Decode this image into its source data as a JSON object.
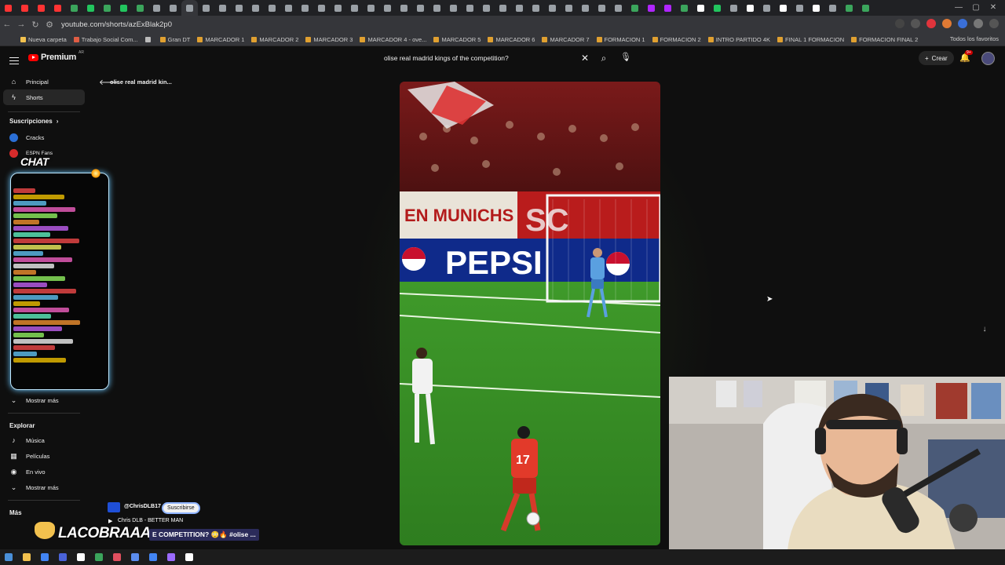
{
  "browser": {
    "url": "youtube.com/shorts/azExBlak2p0",
    "tab_favicon_colors": [
      "#ff3333",
      "#ff3333",
      "#ff3333",
      "#ff3333",
      "#3ba55c",
      "#22c55e",
      "#3ba55c",
      "#22c55e",
      "#3ba55c",
      "#9aa0a6",
      "#9aa0a6",
      "#9aa0a6",
      "#9aa0a6",
      "#9aa0a6",
      "#9aa0a6",
      "#9aa0a6",
      "#9aa0a6",
      "#9aa0a6",
      "#9aa0a6",
      "#9aa0a6",
      "#9aa0a6",
      "#9aa0a6",
      "#9aa0a6",
      "#9aa0a6",
      "#9aa0a6",
      "#9aa0a6",
      "#9aa0a6",
      "#9aa0a6",
      "#9aa0a6",
      "#9aa0a6",
      "#9aa0a6",
      "#9aa0a6",
      "#9aa0a6",
      "#9aa0a6",
      "#9aa0a6",
      "#9aa0a6",
      "#9aa0a6",
      "#9aa0a6",
      "#3ba55c",
      "#b026ff",
      "#b026ff",
      "#3ba55c",
      "#ffffff",
      "#22c55e",
      "#9aa0a6",
      "#ffffff",
      "#9aa0a6",
      "#ffffff",
      "#9aa0a6",
      "#ffffff",
      "#9aa0a6",
      "#3ba55c",
      "#3ba55c"
    ],
    "bookmarks": [
      {
        "label": "Nueva carpeta",
        "color": "#f2c14e"
      },
      {
        "label": "Trabajo Social Com...",
        "color": "#e05d44"
      },
      {
        "label": "",
        "color": "#bbbbbb"
      },
      {
        "label": "Gran DT",
        "color": "#e0a030"
      },
      {
        "label": "MARCADOR 1",
        "color": "#e0a030"
      },
      {
        "label": "MARCADOR 2",
        "color": "#e0a030"
      },
      {
        "label": "MARCADOR 3",
        "color": "#e0a030"
      },
      {
        "label": "MARCADOR 4 - ove...",
        "color": "#e0a030"
      },
      {
        "label": "MARCADOR 5",
        "color": "#e0a030"
      },
      {
        "label": "MARCADOR 6",
        "color": "#e0a030"
      },
      {
        "label": "MARCADOR 7",
        "color": "#e0a030"
      },
      {
        "label": "FORMACION 1",
        "color": "#e0a030"
      },
      {
        "label": "FORMACION 2",
        "color": "#e0a030"
      },
      {
        "label": "INTRO PARTIDO 4K",
        "color": "#e0a030"
      },
      {
        "label": "FINAL 1 FORMACION",
        "color": "#e0a030"
      },
      {
        "label": "FORMACION FINAL 2",
        "color": "#e0a030"
      }
    ],
    "bookmarks_right": "Todos los favoritos"
  },
  "youtube": {
    "logo": "Premium",
    "logo_sup": "AR",
    "search_query": "olise real madrid kings of the competition?",
    "create_label": "Crear",
    "notif_count": "9+",
    "back_title": "olise real madrid kin..."
  },
  "sidebar": {
    "principal": "Principal",
    "shorts": "Shorts",
    "subs_header": "Suscripciones",
    "subs": [
      {
        "label": "Cracks",
        "color": "#2b6fd6"
      },
      {
        "label": "ESPN Fans",
        "color": "#d62b2b"
      }
    ],
    "more_1": "Mostrar más",
    "explore_header": "Explorar",
    "explore": [
      {
        "label": "Música",
        "icon": "♪"
      },
      {
        "label": "Películas",
        "icon": "▦"
      },
      {
        "label": "En vivo",
        "icon": "◉"
      }
    ],
    "more_2": "Mostrar más",
    "mas_header": "Más"
  },
  "overlay": {
    "chat_title": "CHAT",
    "streamer_name": "LACOBRAAA",
    "short_channel": "@ChrisDLB17",
    "short_subscribe": "Suscribirse",
    "short_music": "Chris DLB - BETTER MAN",
    "short_caption": "E COMPETITION? 😳🔥 #olise ..."
  },
  "chat_line_colors": [
    "#ff4d4d",
    "#ffcc00",
    "#66ccff",
    "#ff66cc",
    "#99ff66",
    "#ff9933",
    "#cc66ff",
    "#66ffcc",
    "#ff4d4d",
    "#ffff66",
    "#66ccff",
    "#ff66cc",
    "#ffffff",
    "#ff9933",
    "#99ff66",
    "#cc66ff",
    "#ff4d4d",
    "#66ccff",
    "#ffcc00",
    "#ff66cc",
    "#66ffcc",
    "#ff9933",
    "#cc66ff",
    "#99ff66",
    "#ffffff",
    "#ff4d4d",
    "#66ccff",
    "#ffcc00"
  ],
  "taskbar_icon_colors": [
    "#4a90d9",
    "#f2c14e",
    "#4285f4",
    "#4a63d9",
    "#ffffff",
    "#3ba55c",
    "#e04f5f",
    "#5b8def",
    "#4285f4",
    "#9b6bff",
    "#ffffff"
  ]
}
